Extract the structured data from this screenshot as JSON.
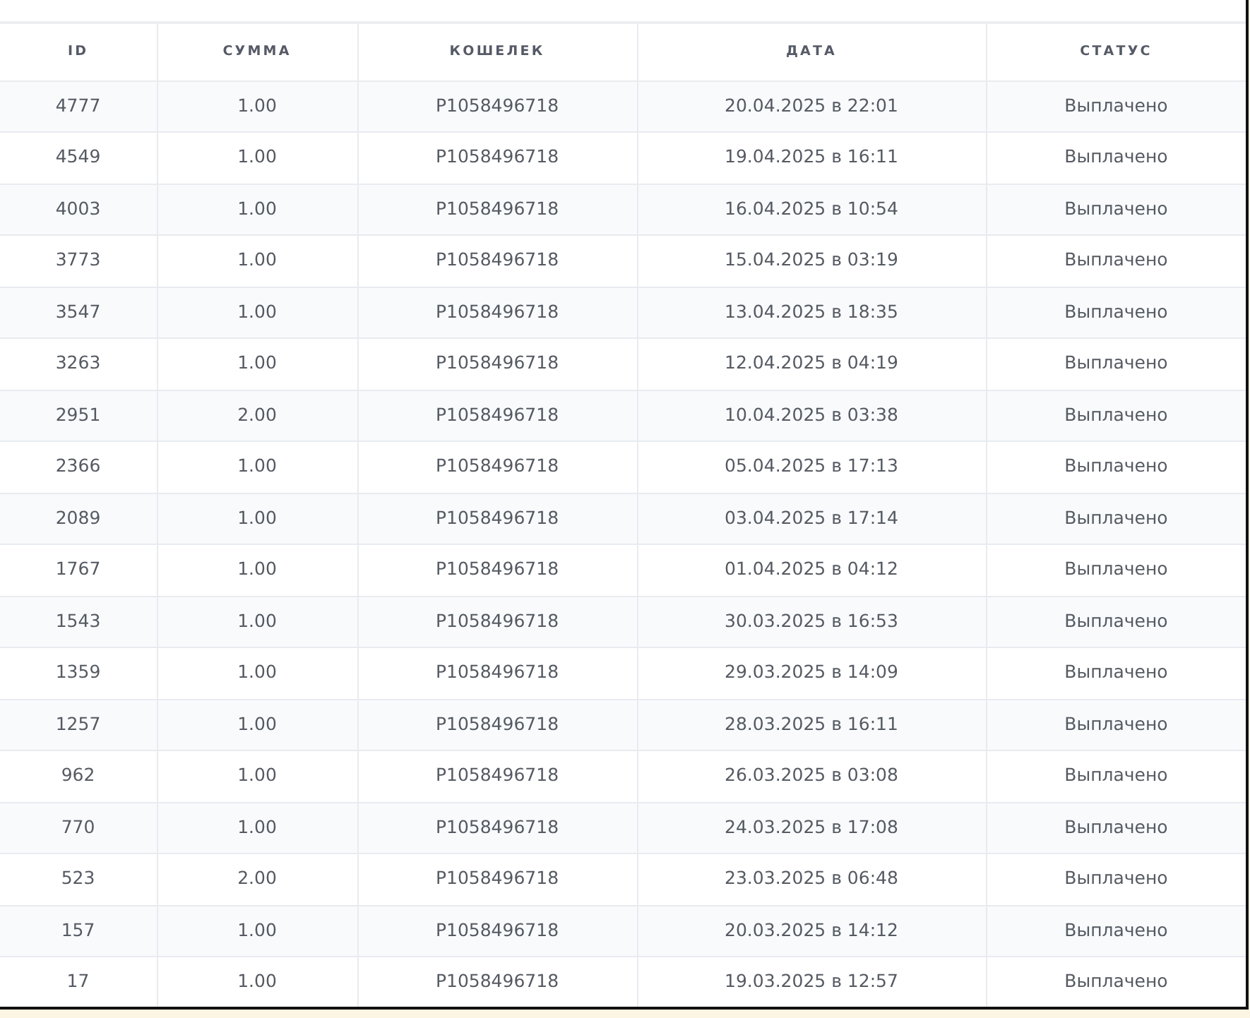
{
  "table": {
    "columns": [
      "ID",
      "СУММА",
      "КОШЕЛЕК",
      "ДАТА",
      "СТАТУС"
    ],
    "rows": [
      [
        "4777",
        "1.00",
        "P1058496718",
        "20.04.2025 в 22:01",
        "Выплачено"
      ],
      [
        "4549",
        "1.00",
        "P1058496718",
        "19.04.2025 в 16:11",
        "Выплачено"
      ],
      [
        "4003",
        "1.00",
        "P1058496718",
        "16.04.2025 в 10:54",
        "Выплачено"
      ],
      [
        "3773",
        "1.00",
        "P1058496718",
        "15.04.2025 в 03:19",
        "Выплачено"
      ],
      [
        "3547",
        "1.00",
        "P1058496718",
        "13.04.2025 в 18:35",
        "Выплачено"
      ],
      [
        "3263",
        "1.00",
        "P1058496718",
        "12.04.2025 в 04:19",
        "Выплачено"
      ],
      [
        "2951",
        "2.00",
        "P1058496718",
        "10.04.2025 в 03:38",
        "Выплачено"
      ],
      [
        "2366",
        "1.00",
        "P1058496718",
        "05.04.2025 в 17:13",
        "Выплачено"
      ],
      [
        "2089",
        "1.00",
        "P1058496718",
        "03.04.2025 в 17:14",
        "Выплачено"
      ],
      [
        "1767",
        "1.00",
        "P1058496718",
        "01.04.2025 в 04:12",
        "Выплачено"
      ],
      [
        "1543",
        "1.00",
        "P1058496718",
        "30.03.2025 в 16:53",
        "Выплачено"
      ],
      [
        "1359",
        "1.00",
        "P1058496718",
        "29.03.2025 в 14:09",
        "Выплачено"
      ],
      [
        "1257",
        "1.00",
        "P1058496718",
        "28.03.2025 в 16:11",
        "Выплачено"
      ],
      [
        "962",
        "1.00",
        "P1058496718",
        "26.03.2025 в 03:08",
        "Выплачено"
      ],
      [
        "770",
        "1.00",
        "P1058496718",
        "24.03.2025 в 17:08",
        "Выплачено"
      ],
      [
        "523",
        "2.00",
        "P1058496718",
        "23.03.2025 в 06:48",
        "Выплачено"
      ],
      [
        "157",
        "1.00",
        "P1058496718",
        "20.03.2025 в 14:12",
        "Выплачено"
      ],
      [
        "17",
        "1.00",
        "P1058496718",
        "19.03.2025 в 12:57",
        "Выплачено"
      ]
    ]
  }
}
